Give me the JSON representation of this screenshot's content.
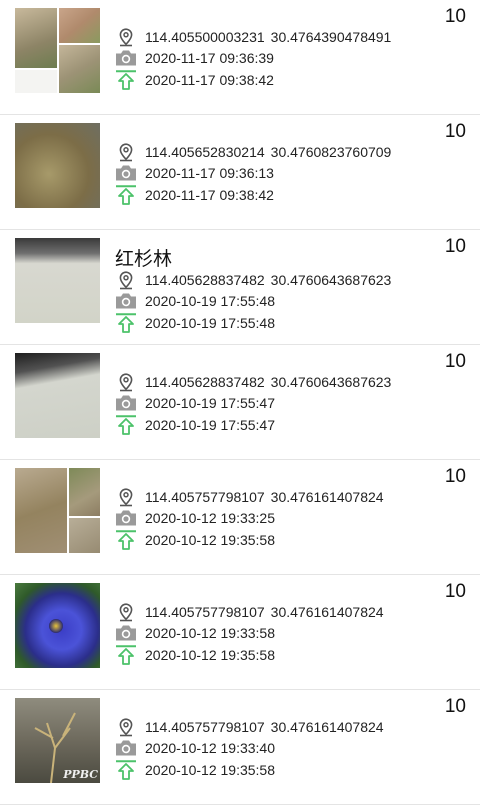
{
  "records": [
    {
      "count": "10",
      "title": "",
      "longitude": "114.405500003231",
      "latitude": "30.4764390478491",
      "captured_time": "2020-11-17 09:36:39",
      "uploaded_time": "2020-11-17 09:38:42",
      "image": "grass-collage"
    },
    {
      "count": "10",
      "title": "",
      "longitude": "114.405652830214",
      "latitude": "30.4760823760709",
      "captured_time": "2020-11-17 09:36:13",
      "uploaded_time": "2020-11-17 09:38:42",
      "image": "dry-grass"
    },
    {
      "count": "10",
      "title": "红杉林",
      "longitude": "114.405628837482",
      "latitude": "30.4760643687623",
      "captured_time": "2020-10-19 17:55:48",
      "uploaded_time": "2020-10-19 17:55:48",
      "image": "wall"
    },
    {
      "count": "10",
      "title": "",
      "longitude": "114.405628837482",
      "latitude": "30.4760643687623",
      "captured_time": "2020-10-19 17:55:47",
      "uploaded_time": "2020-10-19 17:55:47",
      "image": "wall-dark"
    },
    {
      "count": "10",
      "title": "",
      "longitude": "114.405757798107",
      "latitude": "30.476161407824",
      "captured_time": "2020-10-12 19:33:25",
      "uploaded_time": "2020-10-12 19:35:58",
      "image": "bush-collage"
    },
    {
      "count": "10",
      "title": "",
      "longitude": "114.405757798107",
      "latitude": "30.476161407824",
      "captured_time": "2020-10-12 19:33:58",
      "uploaded_time": "2020-10-12 19:35:58",
      "image": "pansy"
    },
    {
      "count": "10",
      "title": "",
      "longitude": "114.405757798107",
      "latitude": "30.476161407824",
      "captured_time": "2020-10-12 19:33:40",
      "uploaded_time": "2020-10-12 19:35:58",
      "image": "twig",
      "watermark": "PPBC"
    }
  ],
  "icons": {
    "location": "location-pin-icon",
    "camera": "camera-icon",
    "upload": "upload-arrow-icon"
  },
  "colors": {
    "icon_gray": "#555555",
    "camera_gray": "#9a9a9a",
    "upload_green": "#4cc26a",
    "divider": "#e4e4e4"
  }
}
